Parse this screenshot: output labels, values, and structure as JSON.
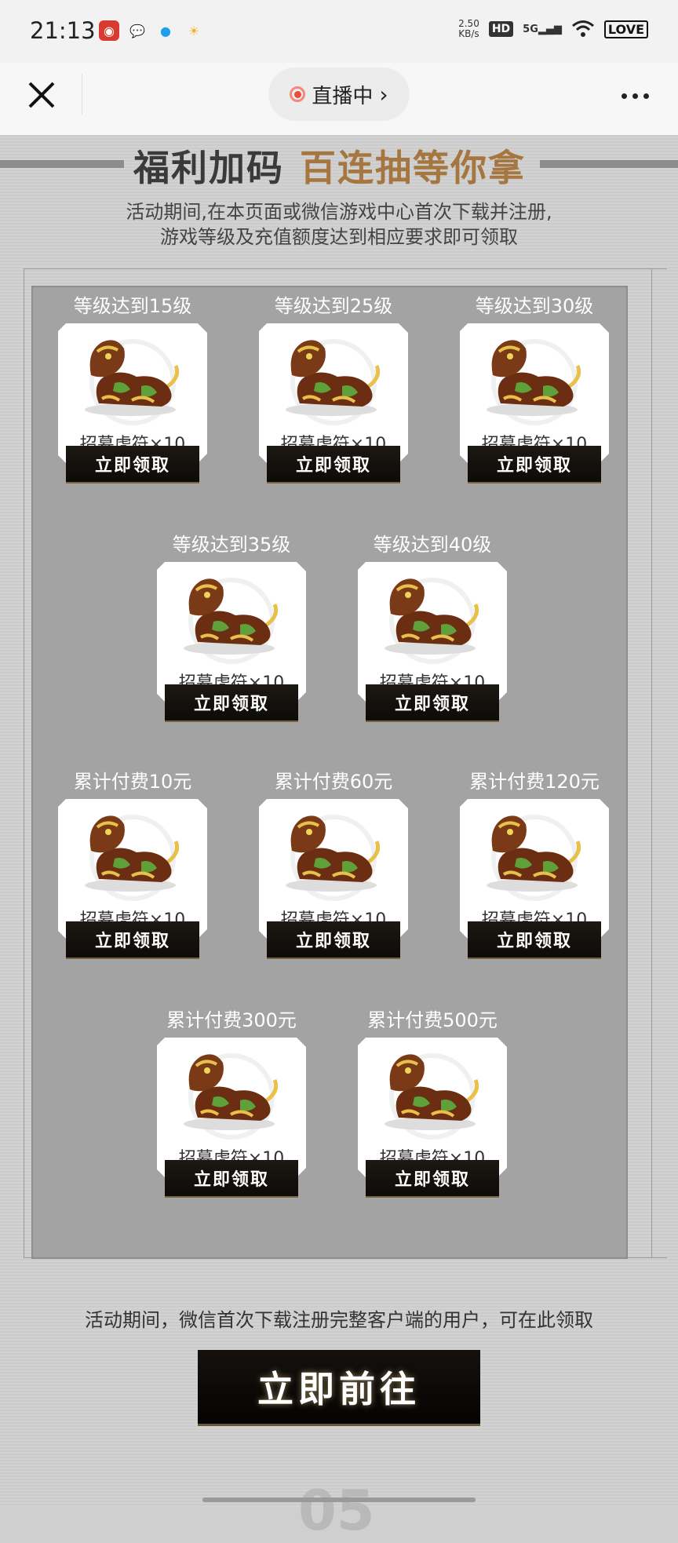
{
  "status_bar": {
    "time": "21:13",
    "net_speed_value": "2.50",
    "net_speed_unit": "KB/s",
    "hd": "HD",
    "network": "5G",
    "battery": "LOVE",
    "icons": [
      "netease-music-icon",
      "wechat-icon",
      "qq-icon",
      "app-icon",
      "signal-icon",
      "wifi-icon",
      "battery-icon"
    ]
  },
  "nav": {
    "live_label": "直播中",
    "close_icon": "close-icon",
    "more_icon": "more-icon"
  },
  "banner": {
    "title_part1": "福利加码",
    "title_part2": "百连抽等你拿"
  },
  "intro": {
    "line1": "活动期间,在本页面或微信游戏中心首次下载并注册,",
    "line2": "游戏等级及充值额度达到相应要求即可领取"
  },
  "rewards": [
    {
      "condition": "等级达到15级",
      "item": "招募虎符×10",
      "button": "立即领取"
    },
    {
      "condition": "等级达到25级",
      "item": "招募虎符×10",
      "button": "立即领取"
    },
    {
      "condition": "等级达到30级",
      "item": "招募虎符×10",
      "button": "立即领取"
    },
    {
      "condition": "等级达到35级",
      "item": "招募虎符×10",
      "button": "立即领取"
    },
    {
      "condition": "等级达到40级",
      "item": "招募虎符×10",
      "button": "立即领取"
    },
    {
      "condition": "累计付费10元",
      "item": "招募虎符×10",
      "button": "立即领取"
    },
    {
      "condition": "累计付费60元",
      "item": "招募虎符×10",
      "button": "立即领取"
    },
    {
      "condition": "累计付费120元",
      "item": "招募虎符×10",
      "button": "立即领取"
    },
    {
      "condition": "累计付费300元",
      "item": "招募虎符×10",
      "button": "立即领取"
    },
    {
      "condition": "累计付费500元",
      "item": "招募虎符×10",
      "button": "立即领取"
    }
  ],
  "footer": {
    "note": "活动期间，微信首次下载注册完整客户端的用户，可在此领取",
    "go_button": "立即前往",
    "deco": "05"
  },
  "colors": {
    "panel": "#a3a3a3",
    "button": "#0d0b08",
    "title_gold": "#a5763f",
    "title_dark": "#3a3a3a"
  }
}
